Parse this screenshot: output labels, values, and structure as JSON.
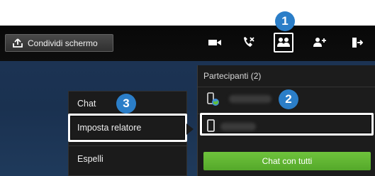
{
  "toolbar": {
    "share_label": "Condividi schermo"
  },
  "participants": {
    "title": "Partecipanti (2)",
    "chat_all_label": "Chat con tutti"
  },
  "context_menu": {
    "items": [
      "Chat",
      "Imposta relatore",
      "Espelli"
    ]
  },
  "callouts": [
    "1",
    "2",
    "3"
  ],
  "colors": {
    "badge": "#2b7ec8",
    "chat_button": "#62b833",
    "highlight": "#ffffff"
  },
  "icons": [
    "share-upload-icon",
    "video-camera-icon",
    "call-end-icon",
    "participants-icon",
    "add-participant-icon",
    "exit-icon",
    "mobile-globe-icon",
    "mobile-phone-icon"
  ]
}
